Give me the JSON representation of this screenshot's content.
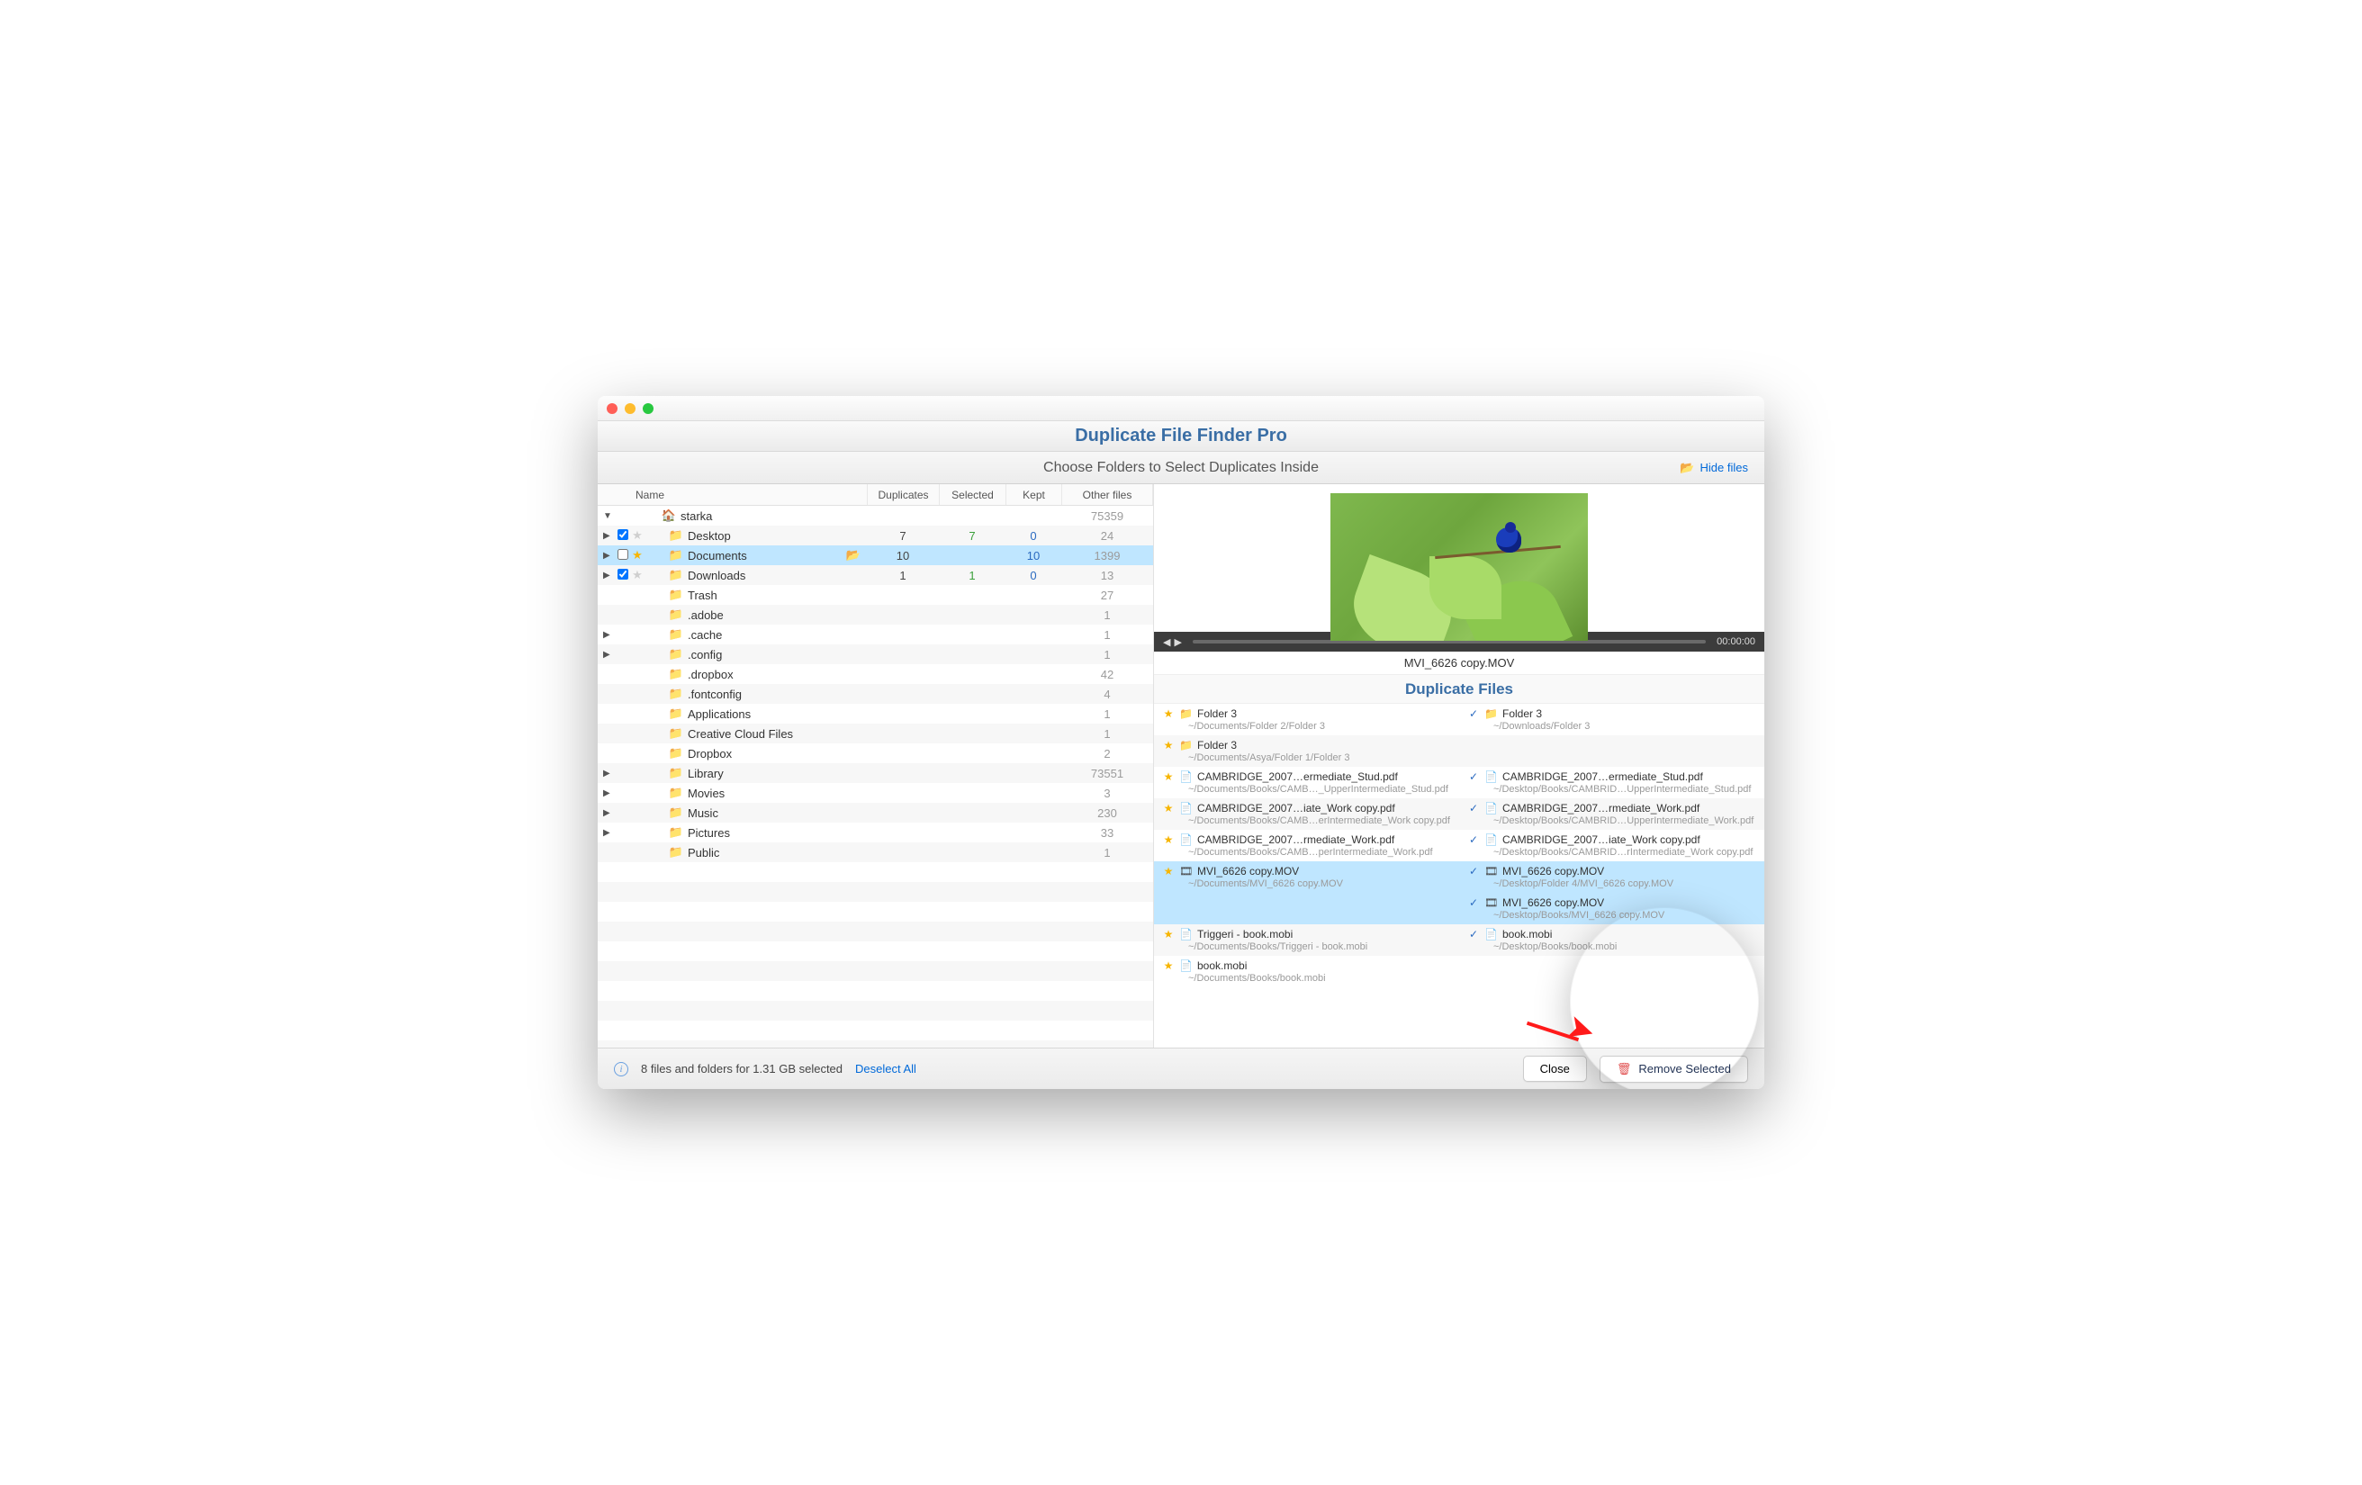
{
  "app": {
    "title": "Duplicate File Finder Pro",
    "subtitle": "Choose Folders to Select Duplicates Inside"
  },
  "hideFiles": "Hide files",
  "columns": {
    "name": "Name",
    "dup": "Duplicates",
    "sel": "Selected",
    "kept": "Kept",
    "other": "Other files"
  },
  "tree": [
    {
      "exp": "▼",
      "cb": "",
      "star": "",
      "icon": "home",
      "label": "starka",
      "dup": "",
      "sel": "",
      "kept": "",
      "oth": "75359",
      "sel_row": false
    },
    {
      "exp": "▶",
      "cb": "on",
      "star": "",
      "icon": "folder",
      "label": "Desktop",
      "dup": "7",
      "sel": "7",
      "kept": "0",
      "oth": "24",
      "sel_row": false
    },
    {
      "exp": "▶",
      "cb": "off",
      "star": "gold",
      "icon": "folder",
      "label": "Documents",
      "dup": "10",
      "sel": "",
      "kept": "10",
      "oth": "1399",
      "sel_row": true,
      "open": true
    },
    {
      "exp": "▶",
      "cb": "on",
      "star": "",
      "icon": "folder",
      "label": "Downloads",
      "dup": "1",
      "sel": "1",
      "kept": "0",
      "oth": "13",
      "sel_row": false
    },
    {
      "exp": "",
      "cb": "",
      "star": "",
      "icon": "folder",
      "label": "Trash",
      "dup": "",
      "sel": "",
      "kept": "",
      "oth": "27"
    },
    {
      "exp": "",
      "cb": "",
      "star": "",
      "icon": "folder",
      "label": ".adobe",
      "dup": "",
      "sel": "",
      "kept": "",
      "oth": "1"
    },
    {
      "exp": "▶",
      "cb": "",
      "star": "",
      "icon": "folder",
      "label": ".cache",
      "dup": "",
      "sel": "",
      "kept": "",
      "oth": "1"
    },
    {
      "exp": "▶",
      "cb": "",
      "star": "",
      "icon": "folder",
      "label": ".config",
      "dup": "",
      "sel": "",
      "kept": "",
      "oth": "1"
    },
    {
      "exp": "",
      "cb": "",
      "star": "",
      "icon": "folder",
      "label": ".dropbox",
      "dup": "",
      "sel": "",
      "kept": "",
      "oth": "42"
    },
    {
      "exp": "",
      "cb": "",
      "star": "",
      "icon": "folder",
      "label": ".fontconfig",
      "dup": "",
      "sel": "",
      "kept": "",
      "oth": "4"
    },
    {
      "exp": "",
      "cb": "",
      "star": "",
      "icon": "folder",
      "label": "Applications",
      "dup": "",
      "sel": "",
      "kept": "",
      "oth": "1"
    },
    {
      "exp": "",
      "cb": "",
      "star": "",
      "icon": "folder",
      "label": "Creative Cloud Files",
      "dup": "",
      "sel": "",
      "kept": "",
      "oth": "1"
    },
    {
      "exp": "",
      "cb": "",
      "star": "",
      "icon": "folder",
      "label": "Dropbox",
      "dup": "",
      "sel": "",
      "kept": "",
      "oth": "2"
    },
    {
      "exp": "▶",
      "cb": "",
      "star": "",
      "icon": "folder",
      "label": "Library",
      "dup": "",
      "sel": "",
      "kept": "",
      "oth": "73551"
    },
    {
      "exp": "▶",
      "cb": "",
      "star": "",
      "icon": "folder",
      "label": "Movies",
      "dup": "",
      "sel": "",
      "kept": "",
      "oth": "3"
    },
    {
      "exp": "▶",
      "cb": "",
      "star": "",
      "icon": "folder",
      "label": "Music",
      "dup": "",
      "sel": "",
      "kept": "",
      "oth": "230"
    },
    {
      "exp": "▶",
      "cb": "",
      "star": "",
      "icon": "folder",
      "label": "Pictures",
      "dup": "",
      "sel": "",
      "kept": "",
      "oth": "33"
    },
    {
      "exp": "",
      "cb": "",
      "star": "",
      "icon": "folder",
      "label": "Public",
      "dup": "",
      "sel": "",
      "kept": "",
      "oth": "1"
    }
  ],
  "preview": {
    "filename": "MVI_6626 copy.MOV",
    "time": "00:00:00",
    "dupHeader": "Duplicate Files"
  },
  "dups": [
    [
      {
        "mark": "star",
        "icon": "folder",
        "name": "Folder 3",
        "path": "~/Documents/Folder 2/Folder 3"
      },
      {
        "mark": "check",
        "icon": "folder",
        "name": "Folder 3",
        "path": "~/Downloads/Folder 3"
      }
    ],
    [
      {
        "mark": "star",
        "icon": "folder",
        "name": "Folder 3",
        "path": "~/Documents/Asya/Folder 1/Folder 3"
      },
      null
    ],
    [
      {
        "mark": "star",
        "icon": "pdf",
        "name": "CAMBRIDGE_2007…ermediate_Stud.pdf",
        "path": "~/Documents/Books/CAMB…_UpperIntermediate_Stud.pdf"
      },
      {
        "mark": "check",
        "icon": "pdf",
        "name": "CAMBRIDGE_2007…ermediate_Stud.pdf",
        "path": "~/Desktop/Books/CAMBRID…UpperIntermediate_Stud.pdf"
      }
    ],
    [
      {
        "mark": "star",
        "icon": "pdf",
        "name": "CAMBRIDGE_2007…iate_Work copy.pdf",
        "path": "~/Documents/Books/CAMB…erIntermediate_Work copy.pdf"
      },
      {
        "mark": "check",
        "icon": "pdf",
        "name": "CAMBRIDGE_2007…rmediate_Work.pdf",
        "path": "~/Desktop/Books/CAMBRID…UpperIntermediate_Work.pdf"
      }
    ],
    [
      {
        "mark": "star",
        "icon": "pdf",
        "name": "CAMBRIDGE_2007…rmediate_Work.pdf",
        "path": "~/Documents/Books/CAMB…perIntermediate_Work.pdf"
      },
      {
        "mark": "check",
        "icon": "pdf",
        "name": "CAMBRIDGE_2007…iate_Work copy.pdf",
        "path": "~/Desktop/Books/CAMBRID…rIntermediate_Work copy.pdf"
      }
    ],
    [
      {
        "mark": "star",
        "icon": "mov",
        "name": "MVI_6626 copy.MOV",
        "path": "~/Documents/MVI_6626 copy.MOV",
        "hl": true
      },
      {
        "mark": "check",
        "icon": "mov",
        "name": "MVI_6626 copy.MOV",
        "path": "~/Desktop/Folder 4/MVI_6626 copy.MOV",
        "hl": true
      }
    ],
    [
      null,
      {
        "mark": "check",
        "icon": "mov",
        "name": "MVI_6626 copy.MOV",
        "path": "~/Desktop/Books/MVI_6626 copy.MOV",
        "hl": true
      }
    ],
    [
      {
        "mark": "star",
        "icon": "mobi",
        "name": "Triggeri - book.mobi",
        "path": "~/Documents/Books/Triggeri - book.mobi"
      },
      {
        "mark": "check",
        "icon": "mobi",
        "name": "book.mobi",
        "path": "~/Desktop/Books/book.mobi"
      }
    ],
    [
      {
        "mark": "star",
        "icon": "mobi",
        "name": "book.mobi",
        "path": "~/Documents/Books/book.mobi"
      },
      null
    ]
  ],
  "footer": {
    "status": "8 files and folders for 1.31 GB selected",
    "deselect": "Deselect All",
    "close": "Close",
    "remove": "Remove Selected"
  }
}
